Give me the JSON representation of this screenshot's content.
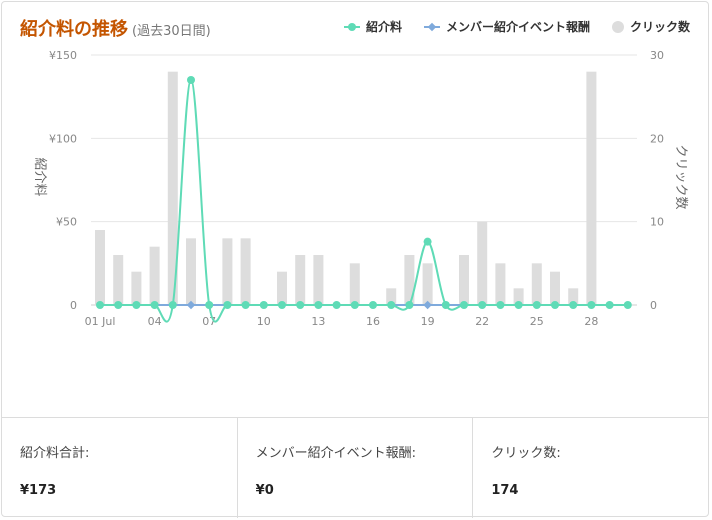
{
  "header": {
    "title": "紹介料の推移",
    "subtitle": "(過去30日間)"
  },
  "legend": {
    "items": [
      {
        "label": "紹介料",
        "color": "#5fdbb6",
        "icon": "line-dot"
      },
      {
        "label": "メンバー紹介イベント報酬",
        "color": "#7faadc",
        "icon": "line-diamond"
      },
      {
        "label": "クリック数",
        "color": "#dddddd",
        "icon": "circle"
      }
    ]
  },
  "chart_data": {
    "type": "bar+line",
    "x": [
      "01 Jul",
      "02 Jul",
      "03 Jul",
      "04 Jul",
      "05 Jul",
      "06 Jul",
      "07 Jul",
      "08 Jul",
      "09 Jul",
      "10 Jul",
      "11 Jul",
      "12 Jul",
      "13 Jul",
      "14 Jul",
      "15 Jul",
      "16 Jul",
      "17 Jul",
      "18 Jul",
      "19 Jul",
      "20 Jul",
      "21 Jul",
      "22 Jul",
      "23 Jul",
      "24 Jul",
      "25 Jul",
      "26 Jul",
      "27 Jul",
      "28 Jul",
      "29 Jul",
      "30 Jul"
    ],
    "x_tick_labels": [
      "01 Jul",
      "",
      "",
      "04",
      "",
      "",
      "07",
      "",
      "",
      "10",
      "",
      "",
      "13",
      "",
      "",
      "16",
      "",
      "",
      "19",
      "",
      "",
      "22",
      "",
      "",
      "25",
      "",
      "",
      "28",
      "",
      ""
    ],
    "left_axis": {
      "label": "紹介料",
      "ticks": [
        "0",
        "¥50",
        "¥100",
        "¥150"
      ],
      "ylim": [
        0,
        150
      ]
    },
    "right_axis": {
      "label": "クリック数",
      "ticks": [
        "0",
        "10",
        "20",
        "30"
      ],
      "ylim": [
        0,
        30
      ]
    },
    "series": [
      {
        "name": "クリック数",
        "type": "bar",
        "axis": "right",
        "color": "#dddddd",
        "values": [
          9,
          6,
          4,
          7,
          28,
          8,
          0,
          8,
          8,
          0,
          4,
          6,
          6,
          0,
          5,
          0,
          2,
          6,
          5,
          0,
          6,
          10,
          5,
          2,
          5,
          4,
          2,
          28,
          0,
          0
        ]
      },
      {
        "name": "紹介料",
        "type": "line",
        "axis": "left",
        "color": "#5fdbb6",
        "values": [
          0,
          0,
          0,
          0,
          0,
          135,
          0,
          0,
          0,
          0,
          0,
          0,
          0,
          0,
          0,
          0,
          0,
          0,
          38,
          0,
          0,
          0,
          0,
          0,
          0,
          0,
          0,
          0,
          0,
          0
        ]
      },
      {
        "name": "メンバー紹介イベント報酬",
        "type": "line",
        "axis": "left",
        "color": "#7faadc",
        "values": [
          0,
          0,
          0,
          0,
          0,
          0,
          0,
          0,
          0,
          0,
          0,
          0,
          0,
          0,
          0,
          0,
          0,
          0,
          0,
          0,
          0,
          0,
          0,
          0,
          0,
          0,
          0,
          0,
          0,
          0
        ]
      }
    ],
    "grid": true
  },
  "footer": {
    "stats": [
      {
        "label": "紹介料合計:",
        "value": "¥173"
      },
      {
        "label": "メンバー紹介イベント報酬:",
        "value": "¥0"
      },
      {
        "label": "クリック数:",
        "value": "174"
      }
    ]
  }
}
